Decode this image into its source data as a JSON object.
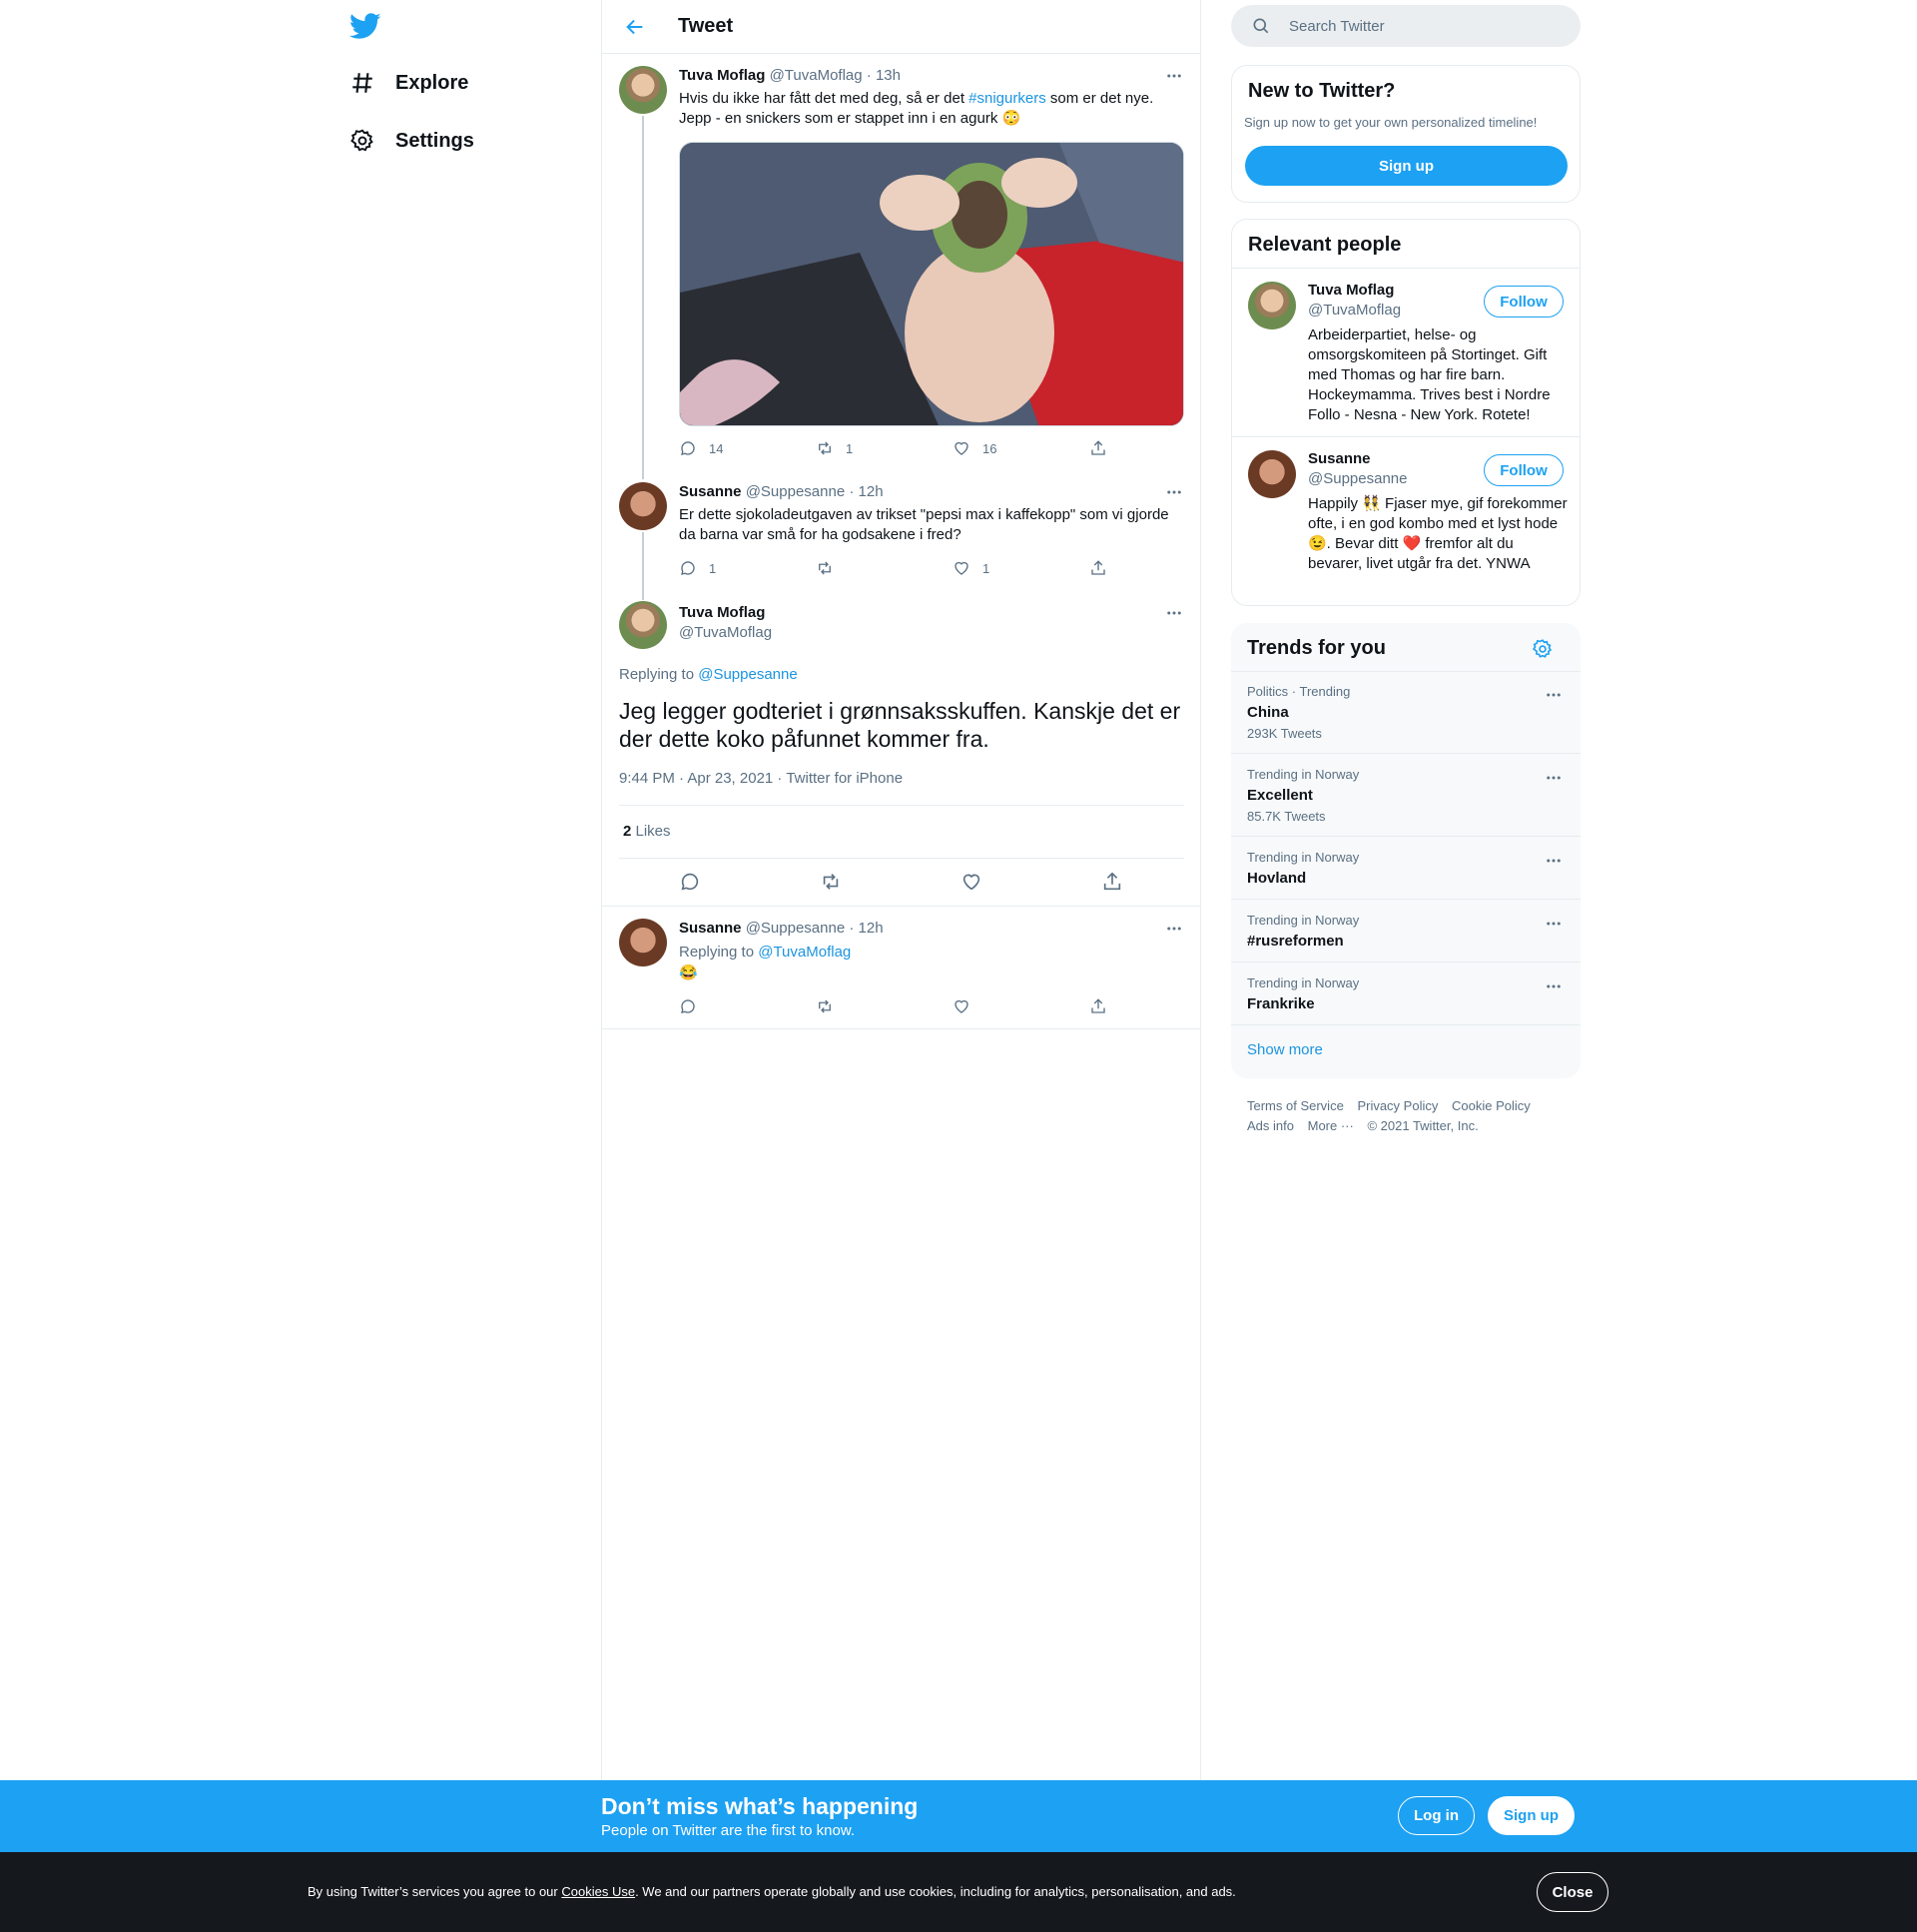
{
  "nav": {
    "logo": "twitter-bird-icon",
    "items": [
      {
        "label": "Explore",
        "icon": "hashtag-icon"
      },
      {
        "label": "Settings",
        "icon": "gear-icon"
      }
    ]
  },
  "header": {
    "title": "Tweet"
  },
  "thread": [
    {
      "name": "Tuva Moflag",
      "handle": "@TuvaMoflag",
      "time": "· 13h",
      "text_before": "Hvis du ikke har fått det med deg, så er det ",
      "hashtag": "#snigurkers",
      "text_after": " som er det nye.",
      "text_line2": "Jepp - en snickers som er stappet inn i en agurk 😳",
      "replies": "14",
      "retweets": "1",
      "likes": "16"
    },
    {
      "name": "Susanne",
      "handle": "@Suppesanne",
      "time": "· 12h",
      "text": "Er dette sjokoladeutgaven av trikset \"pepsi max i kaffekopp\" som vi gjorde da barna var små for ha godsakene i fred?",
      "replies": "1",
      "retweets": "",
      "likes": "1"
    }
  ],
  "main_tweet": {
    "name": "Tuva Moflag",
    "handle": "@TuvaMoflag",
    "replying_prefix": "Replying to ",
    "replying_to": "@Suppesanne",
    "text": "Jeg legger godteriet i grønnsaksskuffen. Kanskje det er der dette koko påfunnet kommer fra.",
    "timestamp": "9:44 PM · Apr 23, 2021 · Twitter for iPhone",
    "likes_count": "2",
    "likes_label": " Likes"
  },
  "reply": {
    "name": "Susanne",
    "handle": "@Suppesanne",
    "time": "· 12h",
    "replying_prefix": "Replying to ",
    "replying_to": "@TuvaMoflag",
    "text": "😂"
  },
  "search": {
    "placeholder": "Search Twitter"
  },
  "new_to_twitter": {
    "title": "New to Twitter?",
    "subtitle": "Sign up now to get your own personalized timeline!",
    "button": "Sign up"
  },
  "relevant_people": {
    "title": "Relevant people",
    "people": [
      {
        "name": "Tuva Moflag",
        "handle": "@TuvaMoflag",
        "button": "Follow",
        "bio": "Arbeiderpartiet, helse- og omsorgskomiteen på Stortinget. Gift med Thomas og har fire barn. Hockeymamma. Trives best i Nordre Follo - Nesna - New York. Rotete!"
      },
      {
        "name": "Susanne",
        "handle": "@Suppesanne",
        "button": "Follow",
        "bio": "Happily 👯 Fjaser mye, gif forekommer ofte, i en god kombo med et lyst hode😉. Bevar ditt ❤️ fremfor alt du bevarer, livet utgår fra det. YNWA"
      }
    ]
  },
  "trends": {
    "title": "Trends for you",
    "items": [
      {
        "context": "Politics · Trending",
        "name": "China",
        "count": "293K Tweets"
      },
      {
        "context": "Trending in Norway",
        "name": "Excellent",
        "count": "85.7K Tweets"
      },
      {
        "context": "Trending in Norway",
        "name": "Hovland",
        "count": ""
      },
      {
        "context": "Trending in Norway",
        "name": "#rusreformen",
        "count": ""
      },
      {
        "context": "Trending in Norway",
        "name": "Frankrike",
        "count": ""
      }
    ],
    "show_more": "Show more"
  },
  "footer": {
    "links": [
      "Terms of Service",
      "Privacy Policy",
      "Cookie Policy",
      "Ads info",
      "More ···"
    ],
    "copyright": "© 2021 Twitter, Inc."
  },
  "banner": {
    "title": "Don’t miss what’s happening",
    "subtitle": "People on Twitter are the first to know.",
    "login": "Log in",
    "signup": "Sign up"
  },
  "cookie": {
    "text_before": "By using Twitter’s services you agree to our ",
    "link": "Cookies Use",
    "text_after": ". We and our partners operate globally and use cookies, including for analytics, personalisation, and ads.",
    "close": "Close"
  },
  "colors": {
    "accent": "#1da1f2",
    "text": "#0f1419",
    "secondary": "#5b7083"
  }
}
